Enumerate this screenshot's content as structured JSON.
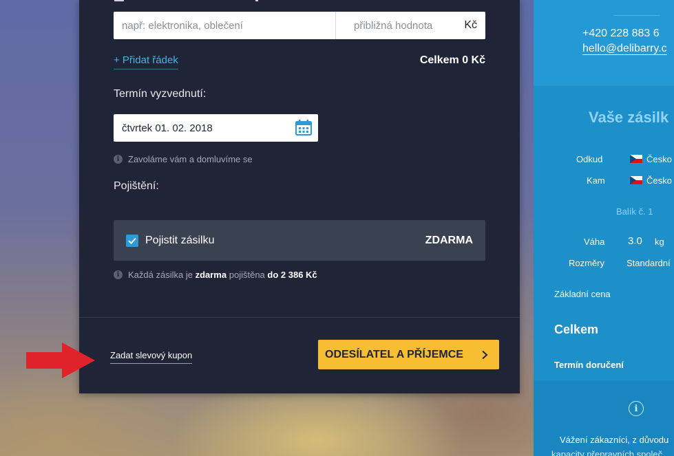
{
  "form": {
    "item_placeholder": "např: elektronika, oblečení",
    "value_placeholder": "přibližná hodnota",
    "currency": "Kč",
    "add_row": "+ Přidat řádek",
    "total": "Celkem 0 Kč",
    "pickup_label": "Termín vyzvednutí:",
    "pickup_date": "čtvrtek 01. 02. 2018",
    "pickup_hint": "Zavoláme vám a domluvíme se",
    "insurance_label": "Pojištění:",
    "insure_checkbox_label": "Pojistit zásilku",
    "insure_checked": true,
    "insure_price": "ZDARMA",
    "insurance_hint_1": "Každá zásilka je",
    "insurance_hint_2": "zdarma",
    "insurance_hint_3": "pojištěna",
    "insurance_hint_4": "do 2 386 Kč",
    "coupon_link": "Zadat slevový kupon",
    "next_button": "ODESÍLATEL A PŘÍJEMCE"
  },
  "sidebar": {
    "phone": "+420 228 883 6",
    "email": "hello@delibarry.c",
    "title": "Vaše zásilk",
    "from_label": "Odkud",
    "from_value": "Česko",
    "to_label": "Kam",
    "to_value": "Česko",
    "parcel": "Balík č. 1",
    "weight_label": "Váha",
    "weight_value": "3.0",
    "weight_unit": "kg",
    "size_label": "Rozměry",
    "size_value": "Standardní",
    "base_price_label": "Základní cena",
    "total_label": "Celkem",
    "delivery_label": "Termín doručení",
    "notice": "Vážení zákazníci, z důvodu",
    "notice_cont": "kapacity přepravních společ"
  },
  "colors": {
    "card_bg": "#1f2536",
    "accent_blue": "#4ab0e4",
    "button_yellow": "#f7bd33",
    "sidebar_blue": "#1d8fc9",
    "arrow_red": "#e0222a"
  },
  "icons": [
    "calendar-icon",
    "info-icon",
    "checkbox-checked-icon",
    "chevron-right-icon",
    "czech-flag-icon",
    "red-arrow-icon"
  ]
}
